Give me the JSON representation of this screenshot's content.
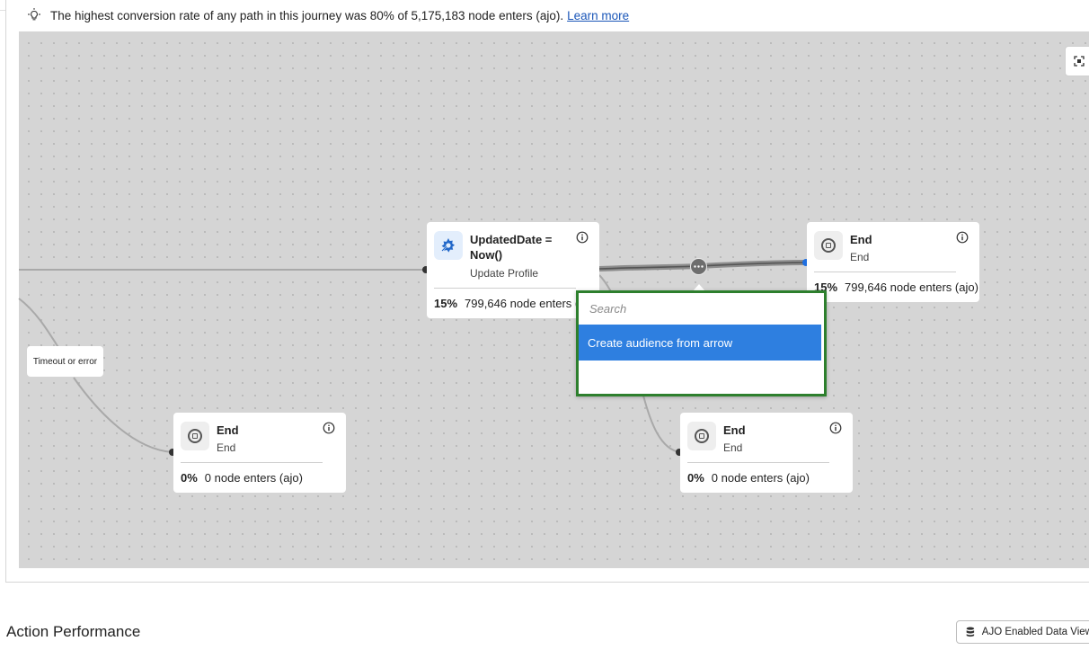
{
  "insight": {
    "text": "The highest conversion rate of any path in this journey was 80% of 5,175,183 node enters (ajo).",
    "link": "Learn more"
  },
  "canvas": {
    "nodes": [
      {
        "id": "updated-date",
        "title": "UpdatedDate = Now()",
        "subtitle": "Update Profile",
        "pct": "15%",
        "enters": "799,646 node enters (ajo)",
        "icon": "update-profile-icon"
      },
      {
        "id": "end-top",
        "title": "End",
        "subtitle": "End",
        "pct": "15%",
        "enters": "799,646 node enters (ajo)",
        "icon": "stop-icon"
      },
      {
        "id": "end-left",
        "title": "End",
        "subtitle": "End",
        "pct": "0%",
        "enters": "0 node enters (ajo)",
        "icon": "stop-icon"
      },
      {
        "id": "end-mid",
        "title": "End",
        "subtitle": "End",
        "pct": "0%",
        "enters": "0 node enters (ajo)",
        "icon": "stop-icon"
      }
    ],
    "timeout_label": "Timeout or error"
  },
  "popover": {
    "search_placeholder": "Search",
    "items": [
      "Create audience from arrow"
    ]
  },
  "section": {
    "title": "Action Performance"
  },
  "dataview": {
    "label": "AJO Enabled Data View ("
  },
  "colors": {
    "accent": "#2e7fe0",
    "highlight_border": "#2d7f2d",
    "canvas": "#d5d5d5",
    "link": "#1a56b8"
  }
}
